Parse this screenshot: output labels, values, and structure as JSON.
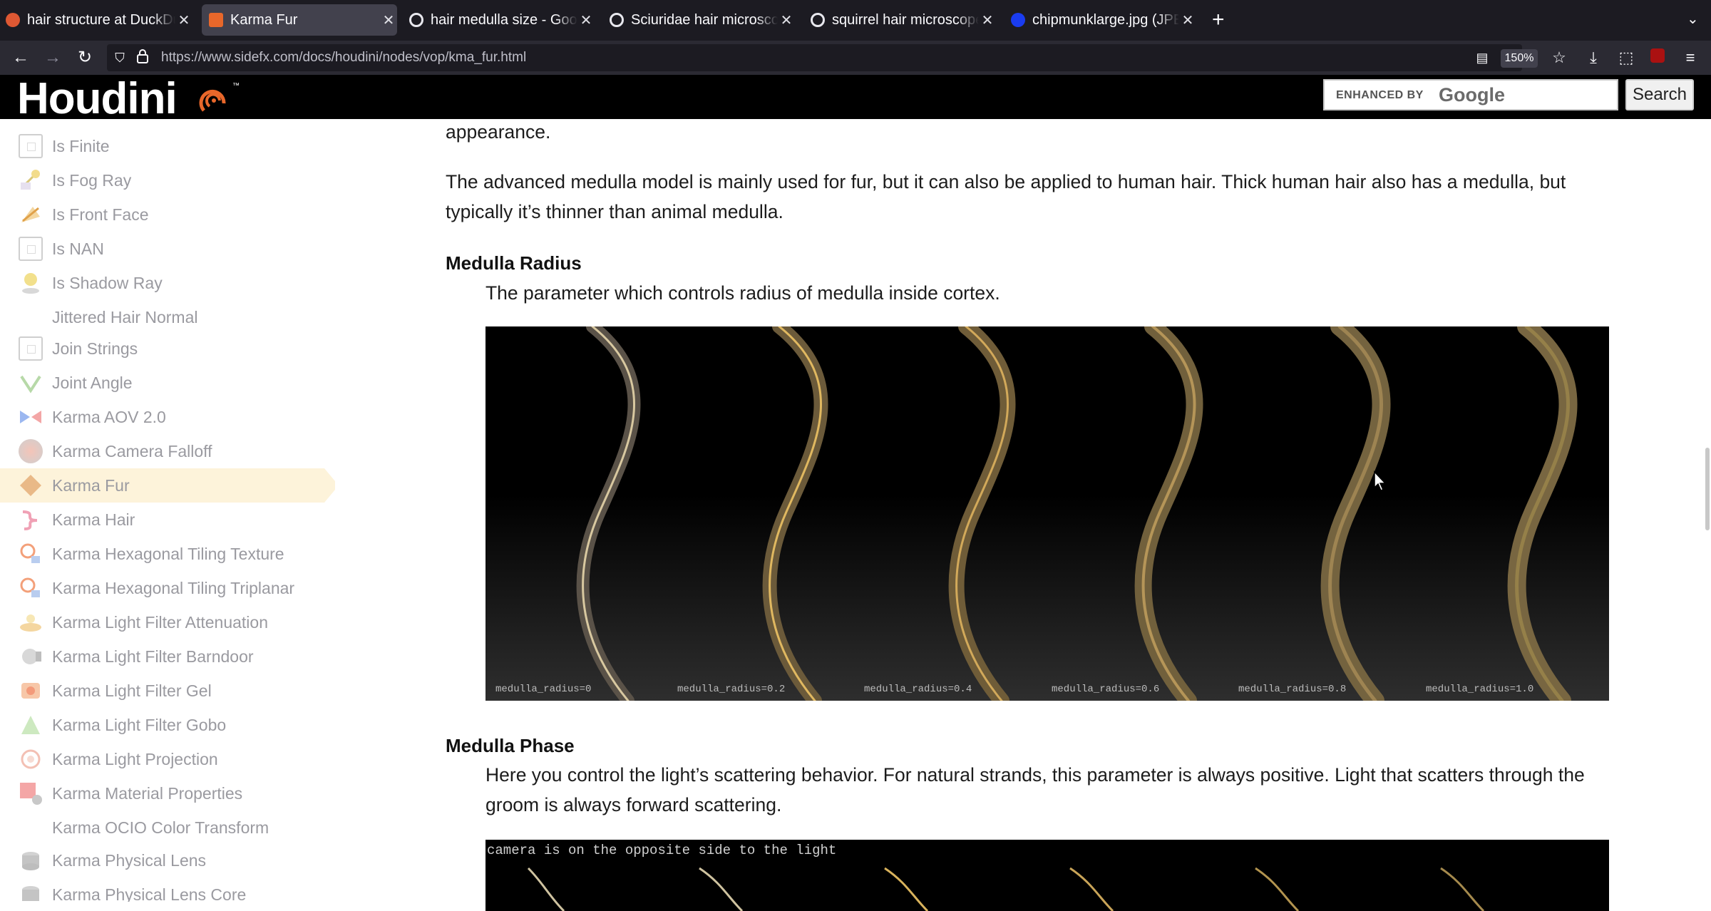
{
  "browser": {
    "tabs": [
      {
        "title": "hair structure at DuckDuckGo",
        "favicon": "duckduckgo-icon",
        "active": false
      },
      {
        "title": "Karma Fur",
        "favicon": "houdini-icon",
        "active": true
      },
      {
        "title": "hair medulla size - Google Search",
        "favicon": "google-icon",
        "active": false
      },
      {
        "title": "Sciuridae hair microscope - Google Search",
        "favicon": "google-icon",
        "active": false
      },
      {
        "title": "squirrel hair microscope - Google Search",
        "favicon": "google-icon",
        "active": false
      },
      {
        "title": "chipmunklarge.jpg (JPEG Image)",
        "favicon": "image-icon",
        "active": false
      }
    ],
    "url": "https://www.sidefx.com/docs/houdini/nodes/vop/kma_fur.html",
    "zoom": "150%"
  },
  "site": {
    "logo": "Houdini",
    "trademark": "™",
    "search_enhanced": "ENHANCED BY",
    "search_google": "Google",
    "search_button": "Search"
  },
  "sidebar": {
    "items": [
      {
        "label": "Is Finite",
        "icon": "box-icon"
      },
      {
        "label": "Is Fog Ray",
        "icon": "fog-ray-icon"
      },
      {
        "label": "Is Front Face",
        "icon": "front-face-icon"
      },
      {
        "label": "Is NAN",
        "icon": "box-icon"
      },
      {
        "label": "Is Shadow Ray",
        "icon": "shadow-ray-icon"
      },
      {
        "label": "Jittered Hair Normal",
        "icon": ""
      },
      {
        "label": "Join Strings",
        "icon": "box-icon"
      },
      {
        "label": "Joint Angle",
        "icon": "joint-angle-icon"
      },
      {
        "label": "Karma AOV 2.0",
        "icon": "aov-icon"
      },
      {
        "label": "Karma Camera Falloff",
        "icon": "camera-falloff-icon"
      },
      {
        "label": "Karma Fur",
        "icon": "fur-icon",
        "selected": true
      },
      {
        "label": "Karma Hair",
        "icon": "hair-icon"
      },
      {
        "label": "Karma Hexagonal Tiling Texture",
        "icon": "hex-tiling-icon"
      },
      {
        "label": "Karma Hexagonal Tiling Triplanar",
        "icon": "hex-tiling-icon"
      },
      {
        "label": "Karma Light Filter Attenuation",
        "icon": "light-filter-icon"
      },
      {
        "label": "Karma Light Filter Barndoor",
        "icon": "barndoor-icon"
      },
      {
        "label": "Karma Light Filter Gel",
        "icon": "gel-icon"
      },
      {
        "label": "Karma Light Filter Gobo",
        "icon": "gobo-icon"
      },
      {
        "label": "Karma Light Projection",
        "icon": "projection-icon"
      },
      {
        "label": "Karma Material Properties",
        "icon": "material-properties-icon"
      },
      {
        "label": "Karma OCIO Color Transform",
        "icon": ""
      },
      {
        "label": "Karma Physical Lens",
        "icon": "lens-icon"
      },
      {
        "label": "Karma Physical Lens Core",
        "icon": "lens-icon"
      }
    ]
  },
  "content": {
    "p0": "appearance.",
    "p1_line1": "The advanced medulla model is mainly used for fur, but it can also be applied to human hair. Thick human hair also has a medulla, but",
    "p1_line2": "typically it’s thinner than animal medulla.",
    "h_radius": "Medulla Radius",
    "radius_desc": "The parameter which controls radius of medulla inside cortex.",
    "radius_captions": [
      "medulla_radius=0",
      "medulla_radius=0.2",
      "medulla_radius=0.4",
      "medulla_radius=0.6",
      "medulla_radius=0.8",
      "medulla_radius=1.0"
    ],
    "h_phase": "Medulla Phase",
    "phase_line1": "Here you control the light’s scattering behavior. For natural strands, this parameter is always positive. Light that scatters through the",
    "phase_line2": "groom is always forward scattering.",
    "phase_caption": "camera is on the opposite side to the light"
  }
}
